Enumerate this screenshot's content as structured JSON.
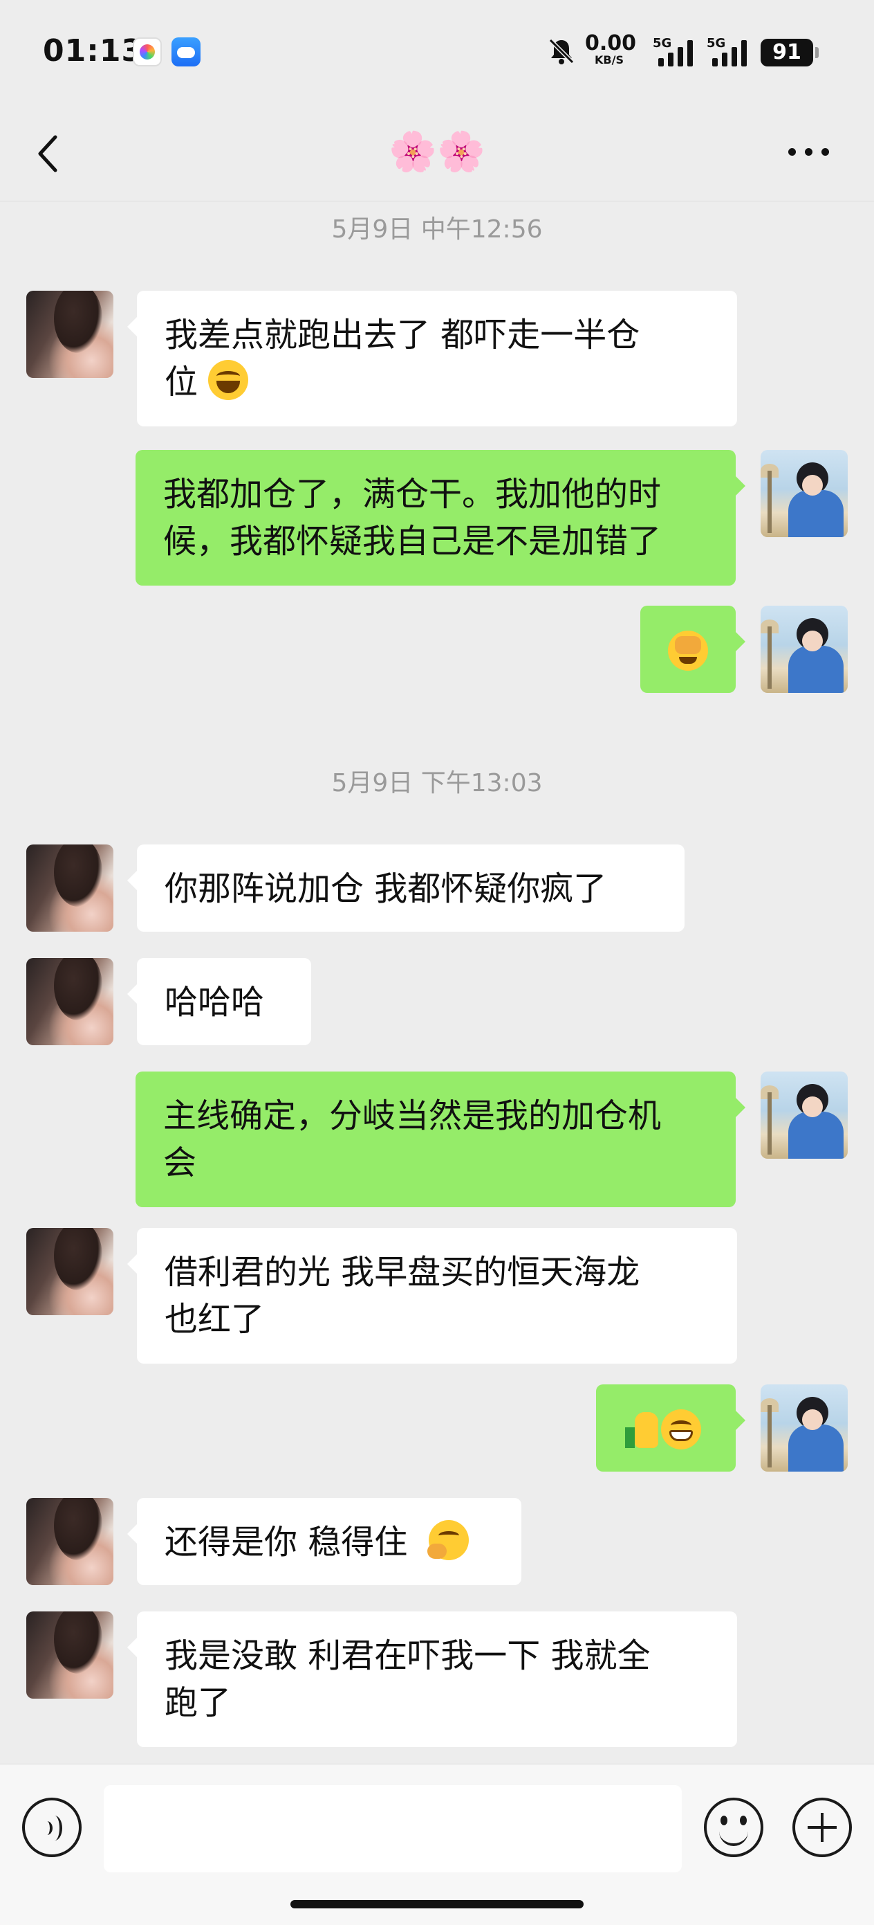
{
  "status_bar": {
    "time": "01:13",
    "net_speed_value": "0.00",
    "net_speed_unit": "KB/S",
    "sim1": "5G",
    "sim2": "5G",
    "battery": "91"
  },
  "header": {
    "title": "🌸🌸"
  },
  "timestamps": [
    "5月9日 中午12:56",
    "5月9日 下午13:03"
  ],
  "messages": [
    {
      "from": "her",
      "text": "我差点就跑出去了 都吓走一半仓",
      "text2": "位",
      "emoji": "laugh-emoji"
    },
    {
      "from": "me",
      "text": "我都加仓了，满仓干。我加他的时",
      "text2": "候，我都怀疑我自己是不是加错了"
    },
    {
      "from": "me",
      "emoji": "facepalm-emoji"
    },
    {
      "from": "her",
      "text": "你那阵说加仓 我都怀疑你疯了"
    },
    {
      "from": "her",
      "text": "哈哈哈"
    },
    {
      "from": "me",
      "text": "主线确定，分岐当然是我的加仓机",
      "text2": "会"
    },
    {
      "from": "her",
      "text": "借利君的光 我早盘买的恒天海龙",
      "text2": "也红了"
    },
    {
      "from": "me",
      "emoji": "thumbs-up-grin-emoji"
    },
    {
      "from": "her",
      "text": "还得是你 稳得住",
      "emoji": "thinking-emoji"
    },
    {
      "from": "her",
      "text": "我是没敢 利君在吓我一下 我就全",
      "text2": "跑了"
    }
  ],
  "input": {
    "placeholder": ""
  }
}
